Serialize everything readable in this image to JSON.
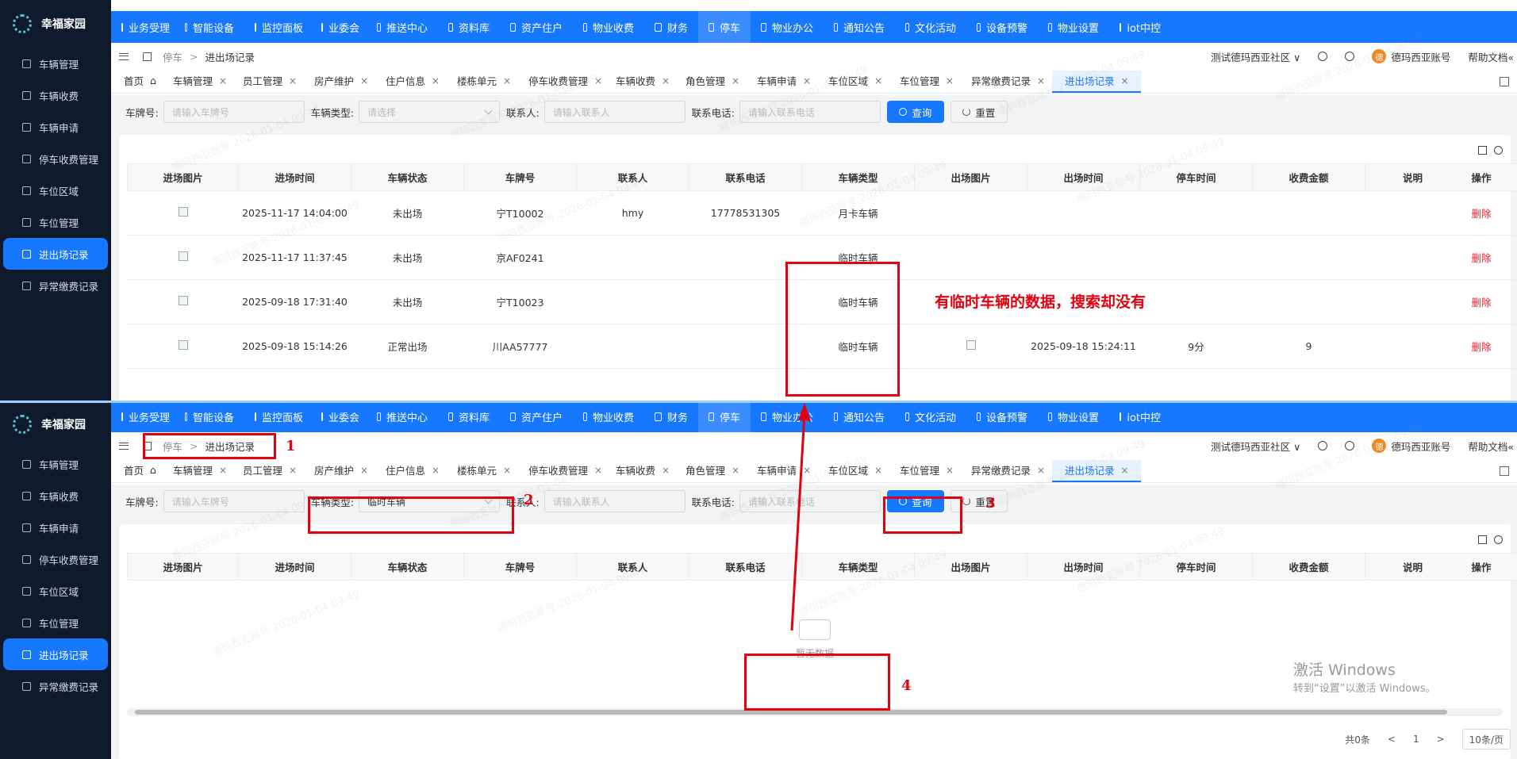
{
  "app": {
    "name": "幸福家园",
    "sidebar_items": [
      "车辆管理",
      "车辆收费",
      "车辆申请",
      "停车收费管理",
      "车位区域",
      "车位管理",
      "进出场记录",
      "异常缴费记录"
    ],
    "nav": [
      "业务受理",
      "智能设备",
      "监控面板",
      "业委会",
      "推送中心",
      "资料库",
      "资产住户",
      "物业收费",
      "财务",
      "停车",
      "物业办公",
      "通知公告",
      "文化活动",
      "设备预警",
      "物业设置",
      "iot中控"
    ],
    "breadcrumb": [
      "停车",
      "进出场记录"
    ],
    "community": "测试德玛西亚社区",
    "account": "德玛西亚账号",
    "avatar": "德",
    "help": "帮助文档",
    "tabs": [
      "首页",
      "车辆管理",
      "员工管理",
      "房产维护",
      "住户信息",
      "楼栋单元",
      "停车收费管理",
      "车辆收费",
      "角色管理",
      "车辆申请",
      "车位区域",
      "车位管理",
      "异常缴费记录",
      "进出场记录"
    ],
    "filters": {
      "plate_label": "车牌号:",
      "plate_placeholder": "请输入车牌号",
      "type_label": "车辆类型:",
      "type_placeholder": "请选择",
      "type_selected": "临时车辆",
      "contact_label": "联系人:",
      "contact_placeholder": "请输入联系人",
      "phone_label": "联系电话:",
      "phone_placeholder": "请输入联系电话",
      "search": "查询",
      "reset": "重置"
    },
    "columns": [
      "进场图片",
      "进场时间",
      "车辆状态",
      "车牌号",
      "联系人",
      "联系电话",
      "车辆类型",
      "出场图片",
      "出场时间",
      "停车时间",
      "收费金额",
      "说明",
      "操作"
    ],
    "rows": [
      [
        "2025-11-17 14:04:00",
        "未出场",
        "宁T10002",
        "hmy",
        "17778531305",
        "月卡车辆",
        "",
        "",
        "",
        ""
      ],
      [
        "2025-11-17 11:37:45",
        "未出场",
        "京AF0241",
        "",
        "",
        "临时车辆",
        "",
        "",
        "",
        ""
      ],
      [
        "2025-09-18 17:31:40",
        "未出场",
        "宁T10023",
        "",
        "",
        "临时车辆",
        "",
        "",
        "",
        ""
      ],
      [
        "2025-09-18 15:14:26",
        "正常出场",
        "川AA57777",
        "",
        "",
        "临时车辆",
        "img",
        "2025-09-18 15:24:11",
        "9分",
        "9"
      ]
    ],
    "delete": "删除",
    "empty": "暂无数据",
    "pager": {
      "total": "共0条",
      "page": "1",
      "size": "10条/页"
    }
  },
  "annotations": {
    "note": "有临时车辆的数据，搜索却没有",
    "n1": "1",
    "n2": "2",
    "n3": "3",
    "n4": "4"
  },
  "watermark": "德玛西亚账号 2026-01-04 09:49",
  "windows": {
    "line1": "激活 Windows",
    "line2": "转到“设置”以激活 Windows。"
  },
  "colors": {
    "primary": "#1677ff",
    "sidebar": "#0f1b2d",
    "annotation": "#e3000f",
    "delete": "#f5222d"
  }
}
